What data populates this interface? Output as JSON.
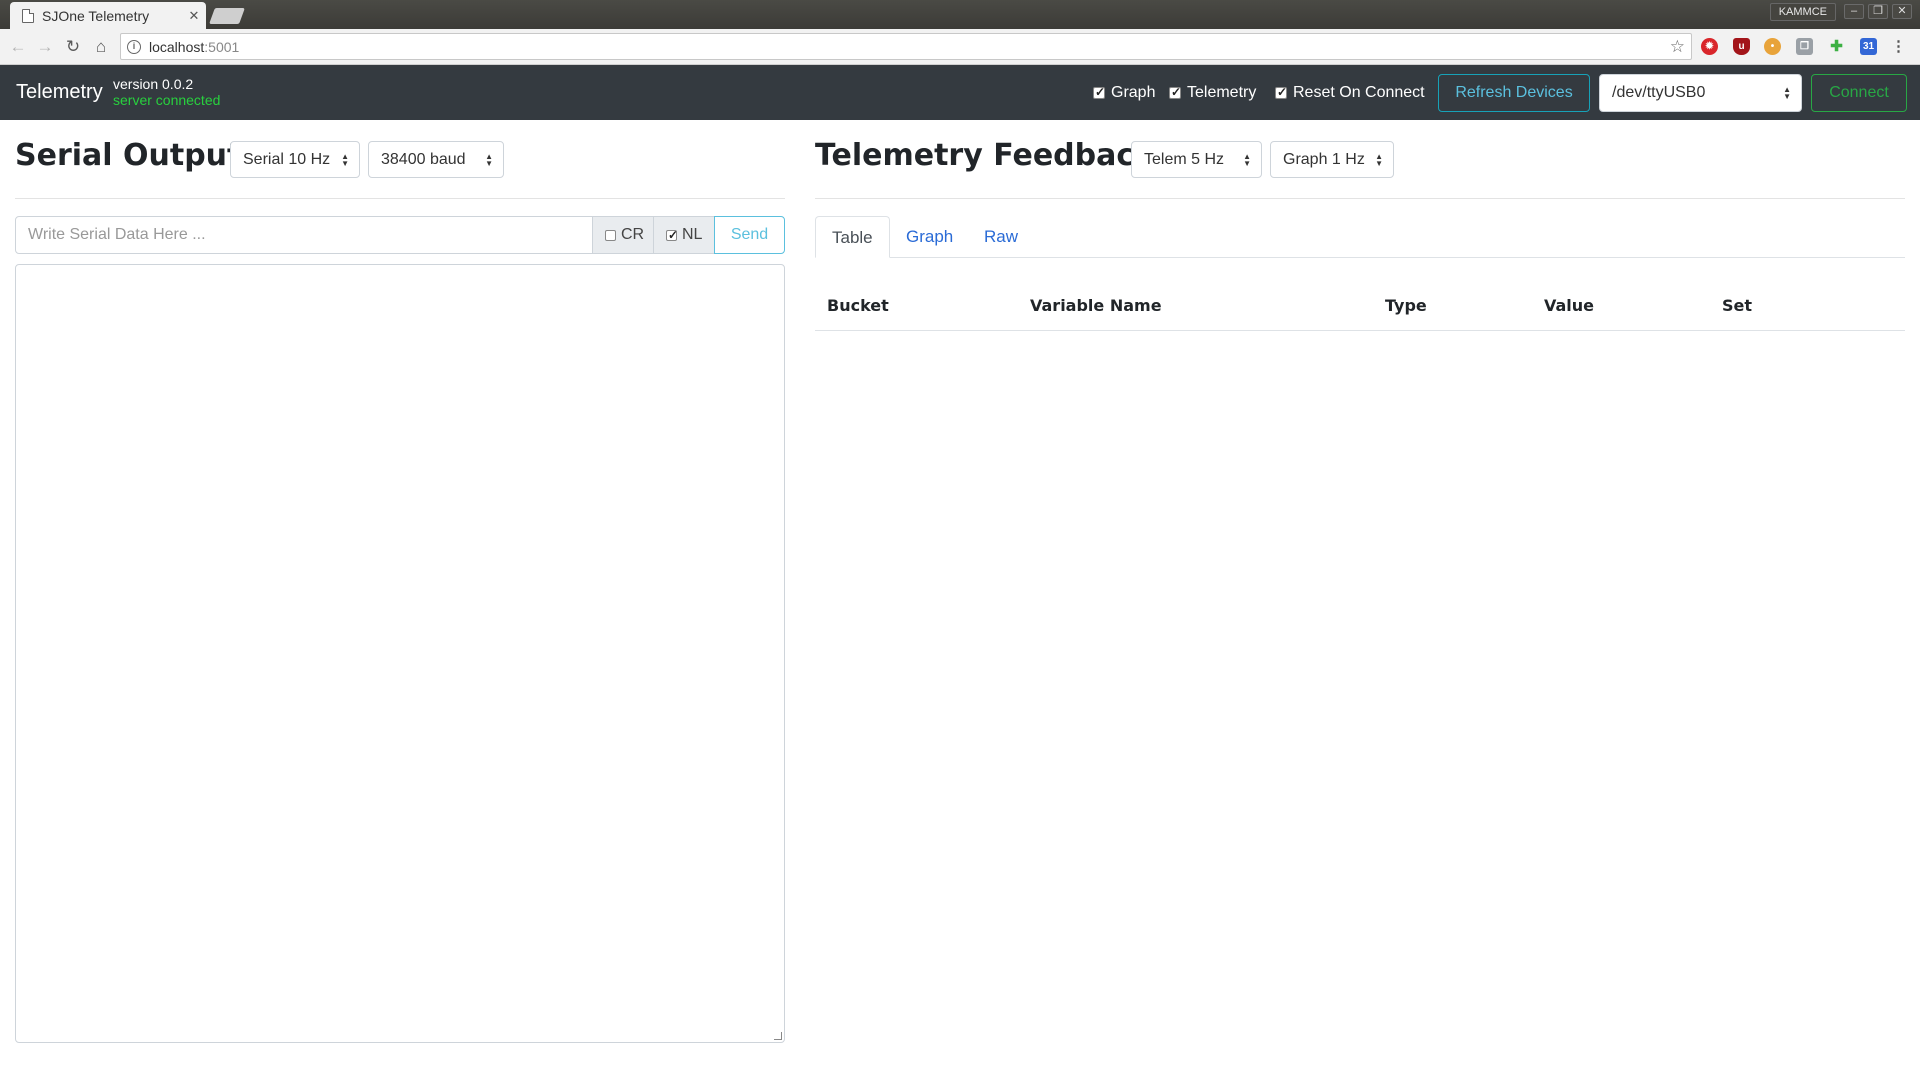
{
  "browser": {
    "tab_title": "SJOne Telemetry",
    "tab_close": "✕",
    "profile_name": "KAMMCE",
    "url_host": "localhost",
    "url_port": ":5001"
  },
  "navbar": {
    "brand": "Telemetry",
    "version": "version 0.0.2",
    "server_status": "server connected",
    "checkboxes": [
      {
        "label": "Graph",
        "checked": true
      },
      {
        "label": "Telemetry",
        "checked": true
      },
      {
        "label": "Reset On Connect",
        "checked": true
      }
    ],
    "refresh_label": "Refresh Devices",
    "device_value": "/dev/ttyUSB0",
    "connect_label": "Connect"
  },
  "serial": {
    "title": "Serial Output",
    "rate_value": "Serial 10 Hz",
    "baud_value": "38400 baud",
    "input_placeholder": "Write Serial Data Here ...",
    "cr_label": "CR",
    "cr_checked": false,
    "nl_label": "NL",
    "nl_checked": true,
    "send_label": "Send",
    "output": ""
  },
  "telemetry": {
    "title": "Telemetry Feedback",
    "telem_rate": "Telem 5 Hz",
    "graph_rate": "Graph 1 Hz",
    "tabs": [
      {
        "label": "Table",
        "active": true
      },
      {
        "label": "Graph",
        "active": false
      },
      {
        "label": "Raw",
        "active": false
      }
    ],
    "columns": [
      "Bucket",
      "Variable Name",
      "Type",
      "Value",
      "Set"
    ],
    "rows": []
  },
  "colors": {
    "navbar_bg": "#343a40",
    "server_ok": "#28d03e",
    "info_btn": "#17a2b8",
    "success_btn": "#28a745",
    "tab_link": "#2a6bd6"
  }
}
